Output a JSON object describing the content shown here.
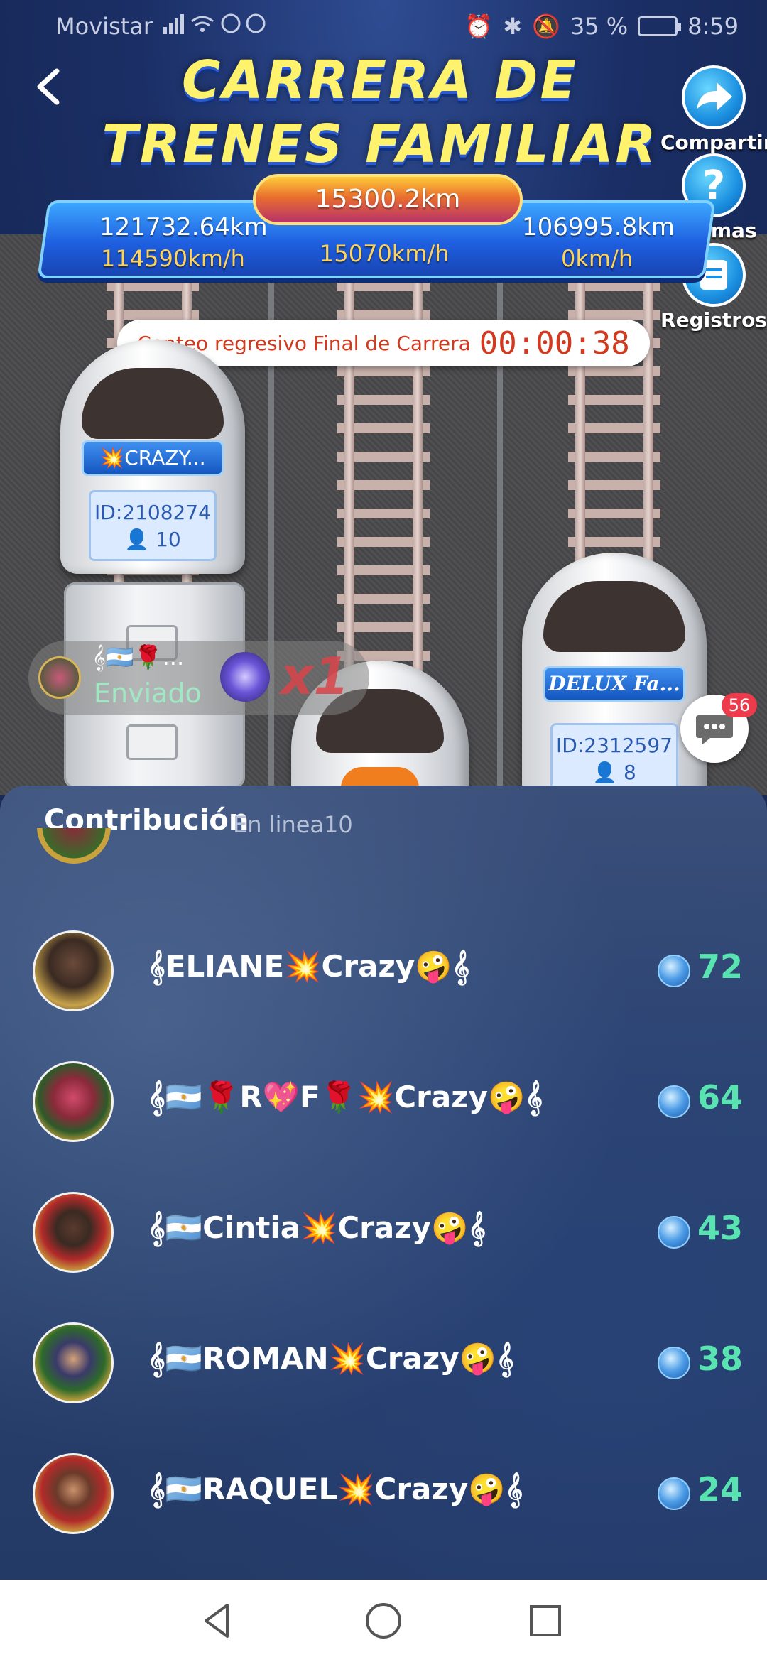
{
  "status_bar": {
    "carrier": "Movistar",
    "battery": "35 %",
    "time": "8:59"
  },
  "header": {
    "title_line1": "CARRERA DE",
    "title_line2": "TRENES FAMILIAR"
  },
  "side_buttons": {
    "share": "Compartir",
    "rules": "Normas",
    "records": "Registros"
  },
  "scoreboard": {
    "total_distance": "15300.2km",
    "left_distance": "121732.64km",
    "right_distance": "106995.8km",
    "left_speed": "114590km/h",
    "center_speed": "15070km/h",
    "right_speed": "0km/h"
  },
  "countdown": {
    "label": "Conteo regresivo Final de Carrera",
    "time": "00:00:38"
  },
  "trains": {
    "left": {
      "name": "💥CRAZY...",
      "id": "ID:2108274",
      "members": "10"
    },
    "right": {
      "name": "DELUX Fa...",
      "id": "ID:2312597",
      "members": "8"
    }
  },
  "gift": {
    "sender": "𝄞🇦🇷🌹...",
    "action": "Enviado",
    "multiplier": "x1"
  },
  "chat": {
    "badge": "56"
  },
  "panel": {
    "title": "Contribución",
    "online": "En linea10",
    "rows": [
      {
        "name": "𝄞ELIANE💥Crazy🤪𝄞",
        "score": "72"
      },
      {
        "name": "𝄞🇦🇷🌹R💖F🌹💥Crazy🤪𝄞",
        "score": "64"
      },
      {
        "name": "𝄞🇦🇷Cintia💥Crazy🤪𝄞",
        "score": "43"
      },
      {
        "name": "𝄞🇦🇷ROMAN💥Crazy🤪𝄞",
        "score": "38"
      },
      {
        "name": "𝄞🇦🇷RAQUEL💥Crazy🤪𝄞",
        "score": "24"
      }
    ]
  },
  "colors": {
    "accent_title": "#fff36d",
    "score_green": "#58e3b1",
    "countdown_red": "#d23a1f"
  },
  "icons": [
    "back-icon",
    "share-icon",
    "help-icon",
    "records-icon",
    "chat-icon",
    "gem-icon",
    "nav-back-icon",
    "nav-home-icon",
    "nav-recents-icon"
  ]
}
